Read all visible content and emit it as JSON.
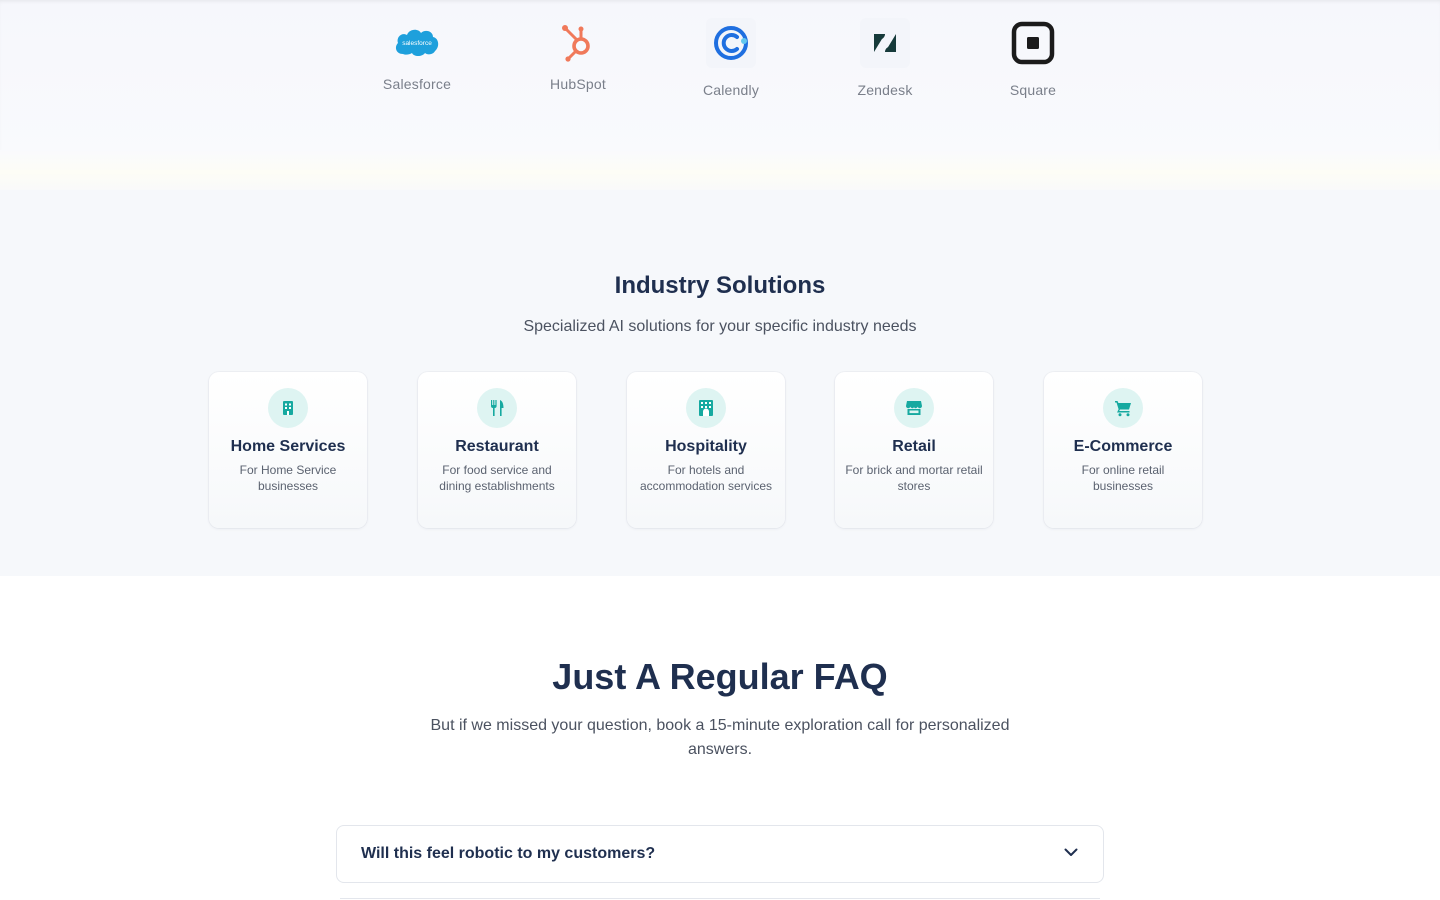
{
  "integrations": [
    {
      "name": "Salesforce",
      "logo_text": "salesforce",
      "icon": "salesforce-cloud-icon",
      "color": "#1ea0dc"
    },
    {
      "name": "HubSpot",
      "icon": "hubspot-sprocket-icon",
      "color": "#f0795a"
    },
    {
      "name": "Calendly",
      "icon": "calendly-icon",
      "color": "#1f6fe0"
    },
    {
      "name": "Zendesk",
      "icon": "zendesk-icon",
      "color": "#163a3a"
    },
    {
      "name": "Square",
      "icon": "square-icon",
      "color": "#1b1b1b"
    }
  ],
  "industry": {
    "title": "Industry Solutions",
    "subtitle": "Specialized AI solutions for your specific industry needs",
    "accent": "#16a9a0",
    "cards": [
      {
        "title": "Home Services",
        "desc": "For Home Service businesses",
        "icon": "building-icon"
      },
      {
        "title": "Restaurant",
        "desc": "For food service and dining establishments",
        "icon": "utensils-icon"
      },
      {
        "title": "Hospitality",
        "desc": "For hotels and accommodation services",
        "icon": "hotel-icon"
      },
      {
        "title": "Retail",
        "desc": "For brick and mortar retail stores",
        "icon": "store-icon"
      },
      {
        "title": "E-Commerce",
        "desc": "For online retail businesses",
        "icon": "shopping-cart-icon"
      }
    ]
  },
  "faq": {
    "title": "Just A Regular FAQ",
    "subtitle": "But if we missed your question, book a 15-minute exploration call for personalized answers.",
    "items": [
      {
        "question": "Will this feel robotic to my customers?",
        "icon": "chevron-down-icon"
      }
    ]
  }
}
